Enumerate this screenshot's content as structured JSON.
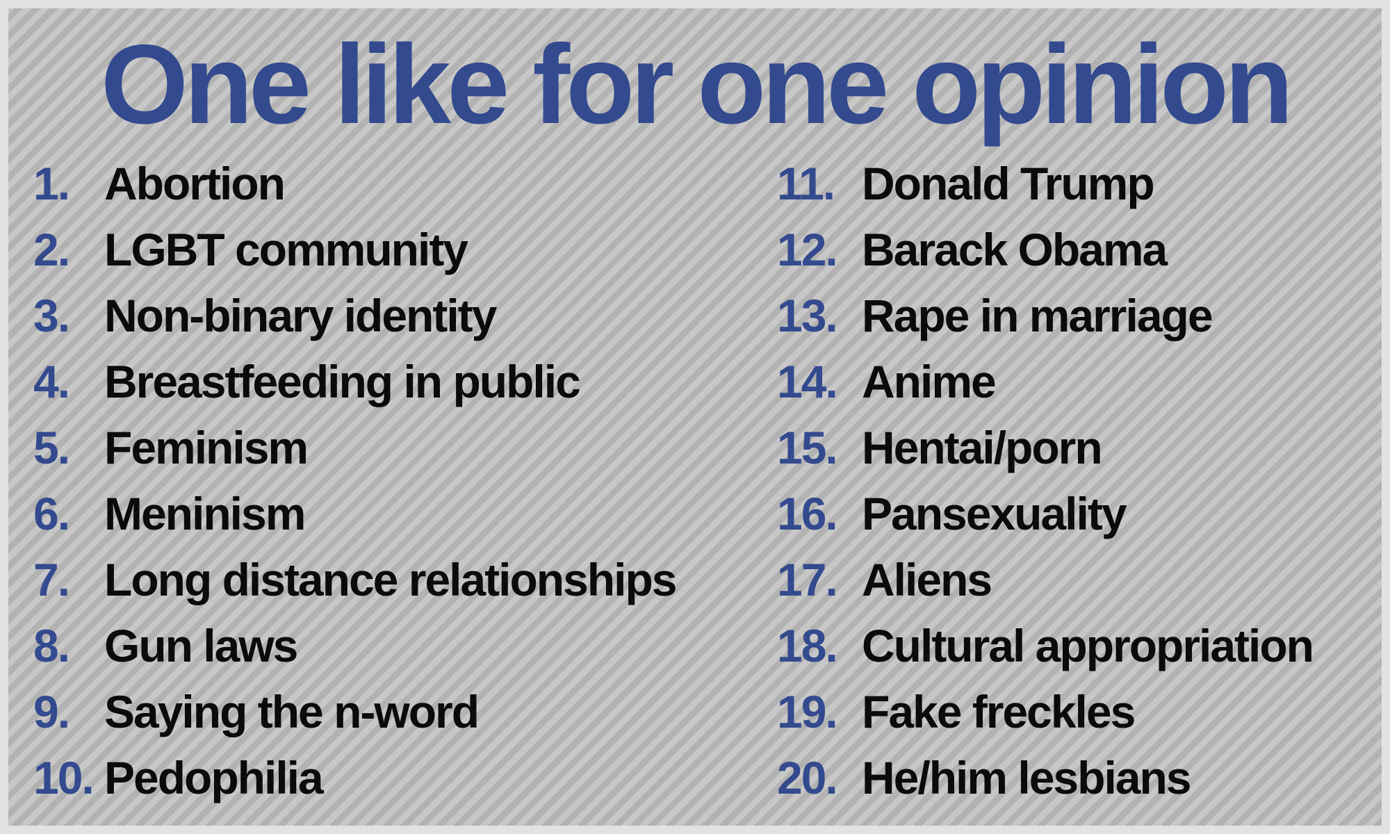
{
  "title": "One like for one opinion",
  "colors": {
    "accent_blue": "#334b8e",
    "text": "#0b0b0b",
    "background_stripe_light": "#c7c7c7",
    "background_stripe_dark": "#b2b2b2"
  },
  "left_column": [
    {
      "num": "1.",
      "label": "Abortion"
    },
    {
      "num": "2.",
      "label": "LGBT community"
    },
    {
      "num": "3.",
      "label": "Non-binary identity"
    },
    {
      "num": "4.",
      "label": "Breastfeeding in public"
    },
    {
      "num": "5.",
      "label": "Feminism"
    },
    {
      "num": "6.",
      "label": "Meninism"
    },
    {
      "num": "7.",
      "label": "Long distance relationships"
    },
    {
      "num": "8.",
      "label": "Gun laws"
    },
    {
      "num": "9.",
      "label": "Saying the n-word"
    },
    {
      "num": "10.",
      "label": "Pedophilia"
    }
  ],
  "right_column": [
    {
      "num": "11.",
      "label": "Donald Trump"
    },
    {
      "num": "12.",
      "label": "Barack Obama"
    },
    {
      "num": "13.",
      "label": "Rape in marriage"
    },
    {
      "num": "14.",
      "label": "Anime"
    },
    {
      "num": "15.",
      "label": "Hentai/porn"
    },
    {
      "num": "16.",
      "label": "Pansexuality"
    },
    {
      "num": "17.",
      "label": "Aliens"
    },
    {
      "num": "18.",
      "label": "Cultural appropriation"
    },
    {
      "num": "19.",
      "label": "Fake freckles"
    },
    {
      "num": "20.",
      "label": "He/him lesbians"
    }
  ]
}
